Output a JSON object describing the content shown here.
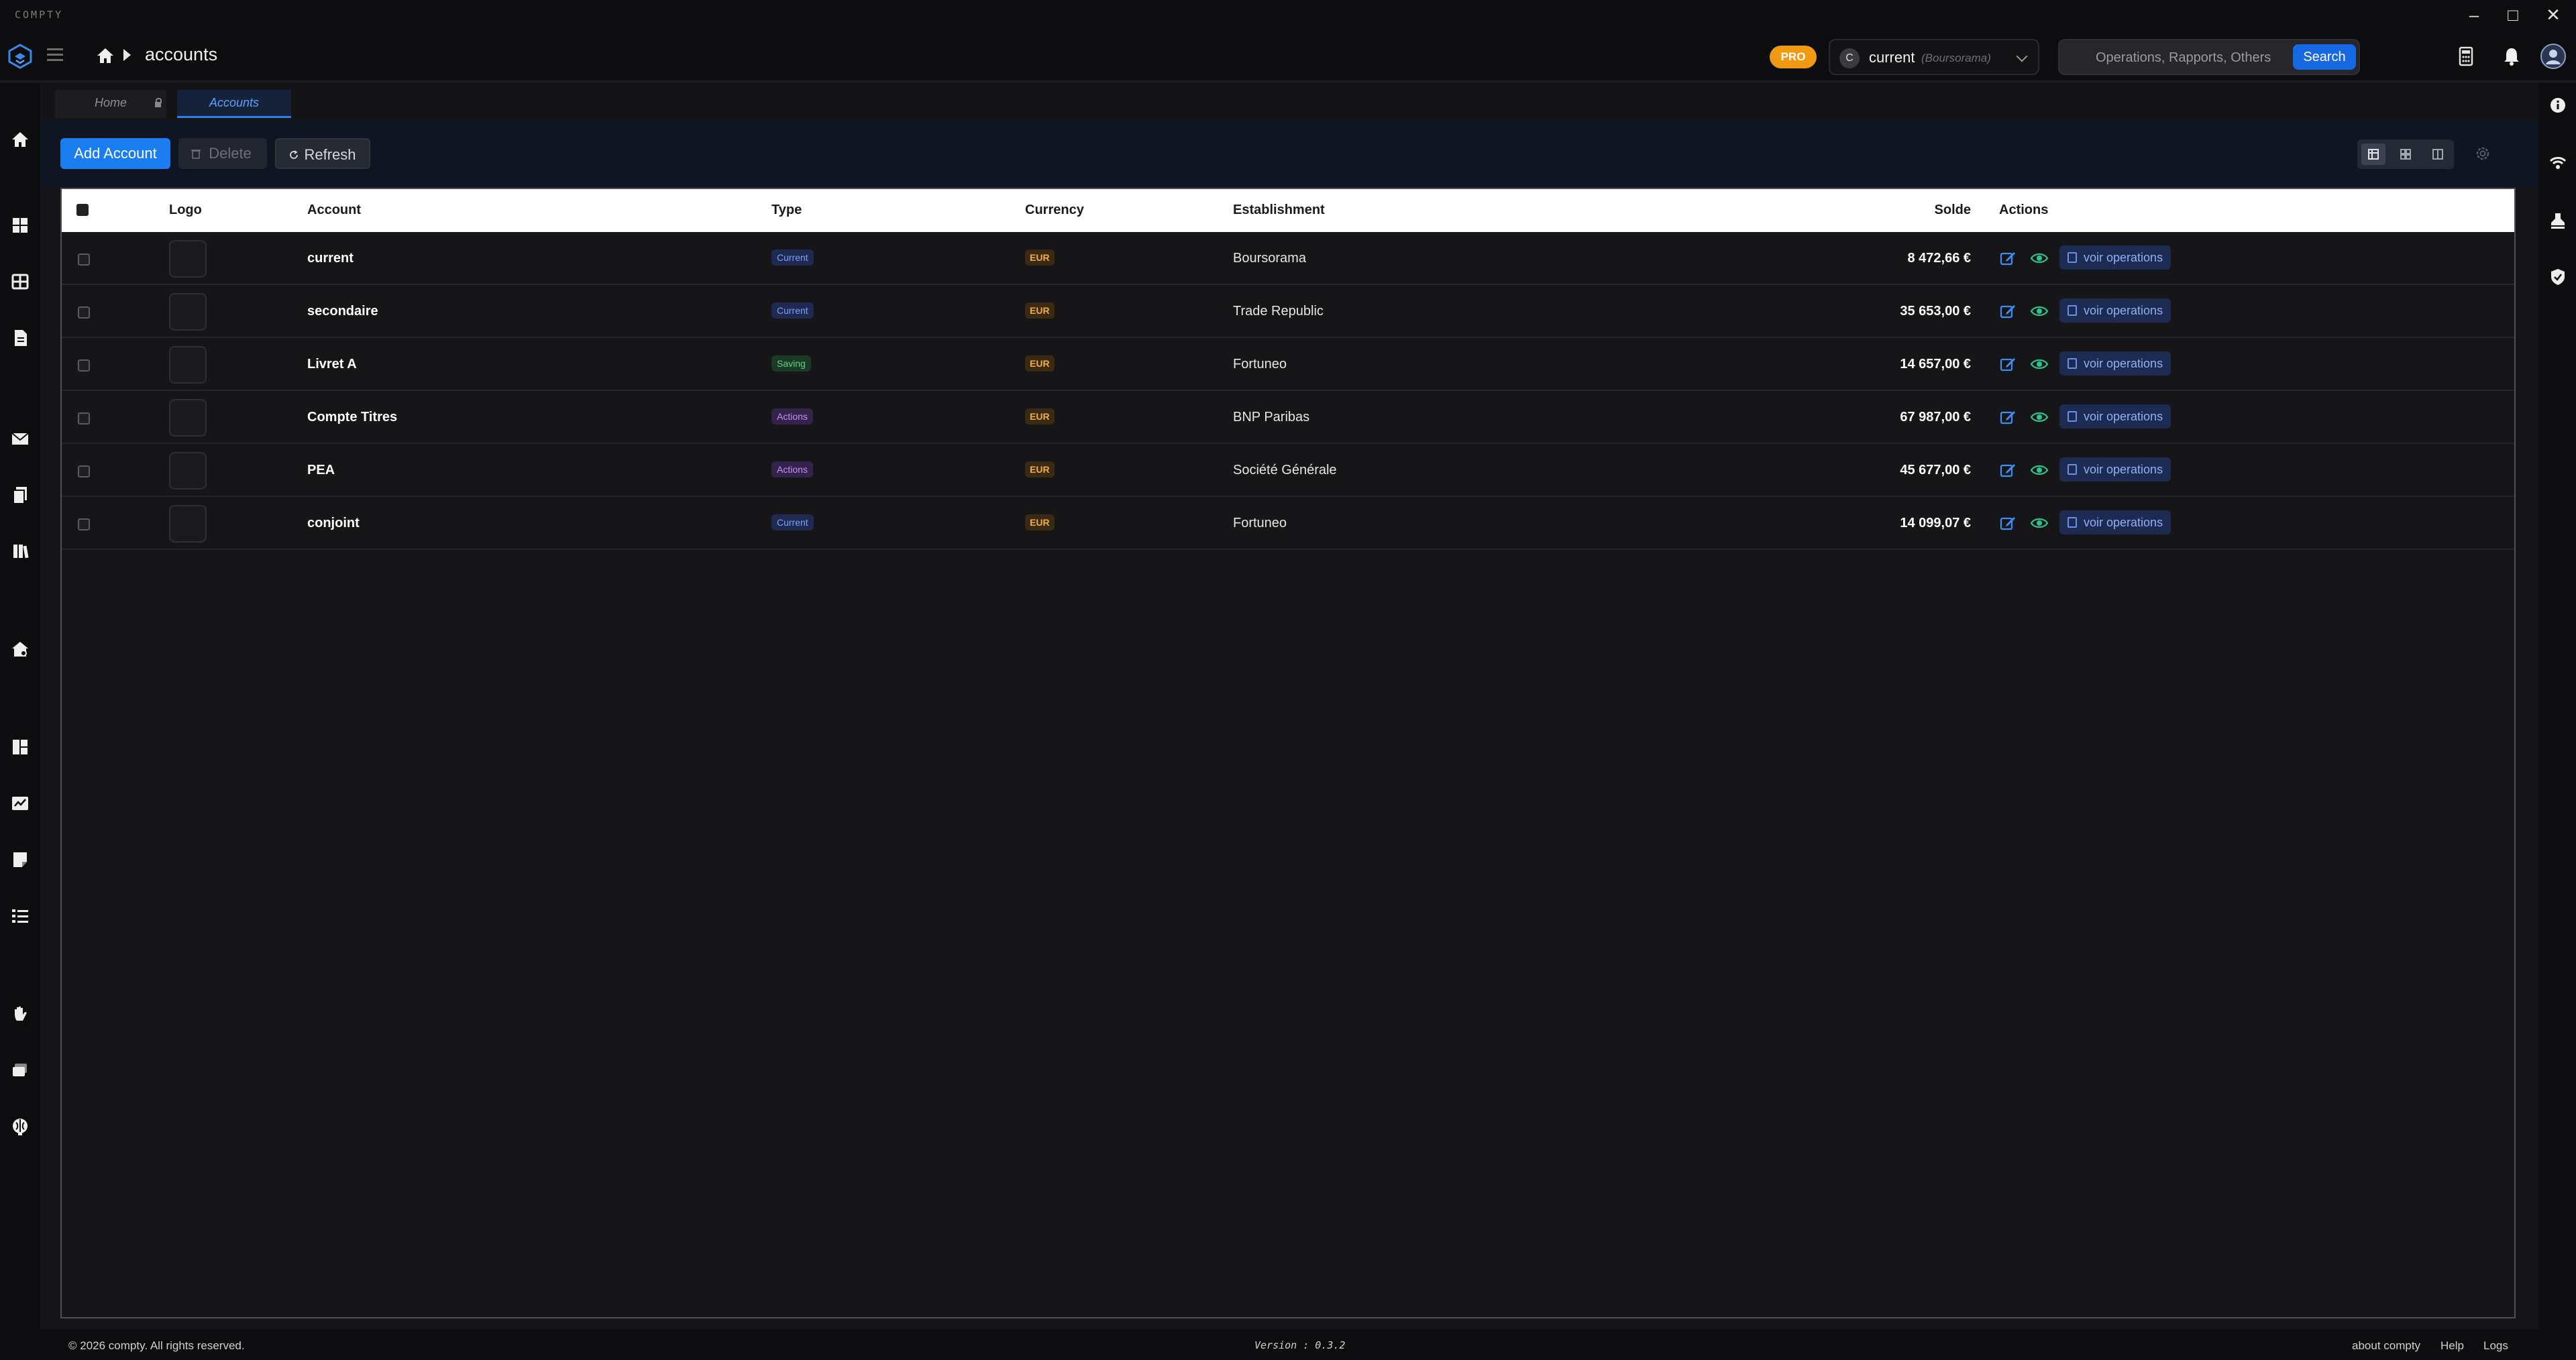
{
  "app": {
    "name": "COMPTY"
  },
  "window_controls": {
    "minimize": "–",
    "maximize": "□",
    "close": "✕"
  },
  "header": {
    "breadcrumb_current": "accounts",
    "pro_label": "PRO",
    "account_selector": {
      "avatar_letter": "C",
      "name": "current",
      "bank": "(Boursorama)"
    },
    "search": {
      "placeholder": "Operations, Rapports, Others",
      "button_label": "Search"
    }
  },
  "tabs": [
    {
      "label": "Home",
      "locked": true,
      "active": false
    },
    {
      "label": "Accounts",
      "locked": false,
      "active": true
    }
  ],
  "toolbar": {
    "add_label": "Add Account",
    "delete_label": "Delete",
    "refresh_label": "Refresh"
  },
  "table": {
    "headers": {
      "logo": "Logo",
      "account": "Account",
      "type": "Type",
      "currency": "Currency",
      "establishment": "Establishment",
      "solde": "Solde",
      "actions": "Actions"
    },
    "action_label": "voir operations",
    "rows": [
      {
        "account": "current",
        "type": "Current",
        "type_kind": "current",
        "currency": "EUR",
        "establishment": "Boursorama",
        "solde": "8 472,66 €"
      },
      {
        "account": "secondaire",
        "type": "Current",
        "type_kind": "current",
        "currency": "EUR",
        "establishment": "Trade Republic",
        "solde": "35 653,00 €"
      },
      {
        "account": "Livret A",
        "type": "Saving",
        "type_kind": "saving",
        "currency": "EUR",
        "establishment": "Fortuneo",
        "solde": "14 657,00 €"
      },
      {
        "account": "Compte Titres",
        "type": "Actions",
        "type_kind": "actions",
        "currency": "EUR",
        "establishment": "BNP Paribas",
        "solde": "67 987,00 €"
      },
      {
        "account": "PEA",
        "type": "Actions",
        "type_kind": "actions",
        "currency": "EUR",
        "establishment": "Société Générale",
        "solde": "45 677,00 €"
      },
      {
        "account": "conjoint",
        "type": "Current",
        "type_kind": "current",
        "currency": "EUR",
        "establishment": "Fortuneo",
        "solde": "14 099,07 €"
      }
    ]
  },
  "footer": {
    "copyright": "© 2026 compty. All rights reserved.",
    "version": "Version : 0.3.2",
    "links": {
      "about": "about compty",
      "help": "Help",
      "logs": "Logs"
    }
  },
  "colors": {
    "accent": "#1a7ef0",
    "pro": "#f09a13",
    "background": "#161618",
    "header_bg": "#0d0d0f"
  },
  "icons": {
    "sidebar": [
      "home-icon",
      "dashboard-icon",
      "grid-icon",
      "document-icon",
      "mail-icon",
      "files-icon",
      "books-icon",
      "house-settings-icon",
      "layout-icon",
      "chart-card-icon",
      "note-icon",
      "checklist-icon",
      "hand-icon",
      "cards-icon",
      "brain-icon"
    ],
    "right_sidebar": [
      "info-icon",
      "signal-icon",
      "stamp-icon",
      "shield-icon"
    ],
    "header": [
      "calculator-icon",
      "bell-icon",
      "user-avatar-icon"
    ]
  }
}
